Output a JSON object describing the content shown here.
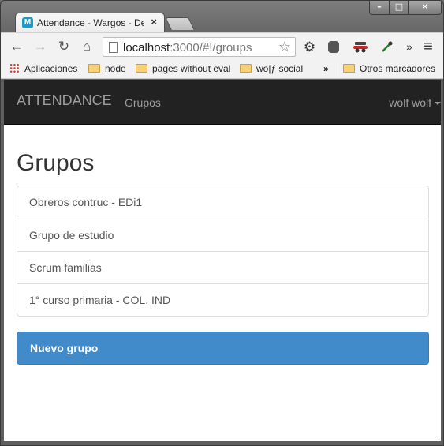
{
  "browser": {
    "tab": {
      "title": "Attendance - Wargos - De",
      "favicon_letter": "M",
      "close_glyph": "×"
    },
    "window_controls": {
      "minimize": "–",
      "maximize": "□",
      "close": "✕"
    },
    "toolbar": {
      "back": "←",
      "forward": "→",
      "reload": "↻",
      "home": "⌂",
      "url_host": "localhost",
      "url_rest": ":3000/#!/groups",
      "bookmark_star": "☆",
      "overflow": "»",
      "menu": "≡"
    },
    "bookmarks": {
      "items": [
        {
          "label": "Aplicaciones",
          "icon": "apps-icon"
        },
        {
          "label": "node",
          "icon": "folder-icon"
        },
        {
          "label": "pages without eval",
          "icon": "folder-icon"
        },
        {
          "label": "wo|ƒ social",
          "icon": "folder-icon"
        }
      ],
      "overflow": "»",
      "other": "Otros marcadores"
    }
  },
  "app": {
    "brand": "ATTENDANCE",
    "nav_link": "Grupos",
    "user": "wolf wolf",
    "heading": "Grupos",
    "groups": [
      "Obreros contruc - EDi1",
      "Grupo de estudio",
      "Scrum familias",
      "1° curso primaria - COL. IND"
    ],
    "new_group_button": "Nuevo grupo",
    "colors": {
      "navbar": "#222222",
      "primary": "#428bca",
      "nav_text": "#9d9d9d"
    }
  }
}
